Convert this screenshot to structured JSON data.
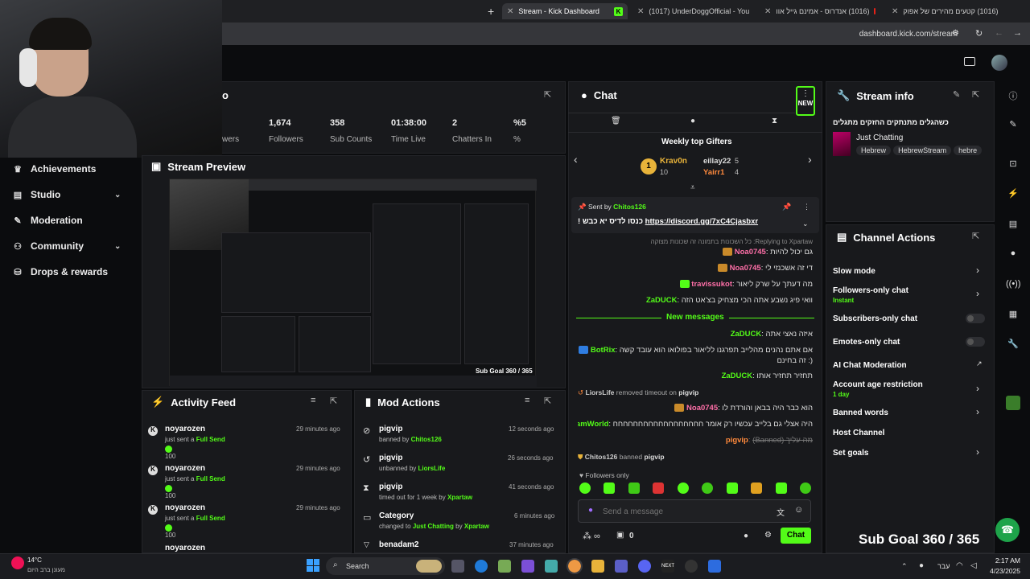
{
  "browser": {
    "tabs": [
      {
        "label": "Stream - Kick Dashboard",
        "active": true
      },
      {
        "label": "(1017) UnderDoggOfficial - You"
      },
      {
        "label": "(1016) אנדרוס - אמינם גייל אוו"
      },
      {
        "label": "(1016) קטעים מהירים של אפוק"
      }
    ],
    "new_tab": "+",
    "url": "dashboard.kick.com/stream"
  },
  "sidebar": {
    "items": [
      {
        "label": "Achievements",
        "icon": "trophy-icon"
      },
      {
        "label": "Studio",
        "icon": "studio-icon",
        "chevron": true
      },
      {
        "label": "Moderation",
        "icon": "wrench-icon"
      },
      {
        "label": "Community",
        "icon": "community-icon",
        "chevron": true
      },
      {
        "label": "Drops & rewards",
        "icon": "drops-icon"
      }
    ]
  },
  "session": {
    "title_suffix": "o",
    "stats": [
      {
        "value": "1,674",
        "label": "Followers"
      },
      {
        "value": "358",
        "label": "Sub Counts"
      },
      {
        "value": "01:38:00",
        "label": "Time Live"
      },
      {
        "value": "2",
        "label": "Chatters In"
      },
      {
        "value": "%5",
        "label": "%"
      }
    ],
    "viewers_label": "wers"
  },
  "preview": {
    "title": "Stream Preview",
    "overlay_goal": "Sub Goal 360 / 365"
  },
  "activity": {
    "title": "Activity Feed",
    "items": [
      {
        "name": "noyarozen",
        "action": "just sent a",
        "gift": "Full Send",
        "amount": "100",
        "time": "29 minutes ago"
      },
      {
        "name": "noyarozen",
        "action": "just sent a",
        "gift": "Full Send",
        "amount": "100",
        "time": "29 minutes ago"
      },
      {
        "name": "noyarozen",
        "action": "just sent a",
        "gift": "Full Send",
        "amount": "100",
        "time": "29 minutes ago"
      },
      {
        "name": "noyarozen"
      }
    ]
  },
  "mod": {
    "title": "Mod Actions",
    "items": [
      {
        "name": "pigvip",
        "prefix": "banned by",
        "by": "Chitos126",
        "time": "12 seconds ago"
      },
      {
        "name": "pigvip",
        "prefix": "unbanned by",
        "by": "LiorsLife",
        "time": "26 seconds ago"
      },
      {
        "name": "pigvip",
        "prefix": "timed out for 1 week by",
        "by": "Xpartaw",
        "time": "41 seconds ago"
      },
      {
        "name": "Category",
        "prefix": "changed to",
        "by": "Just Chatting",
        "by2": "by",
        "by3": "Xpartaw",
        "time": "6 minutes ago"
      },
      {
        "name": "benadam2",
        "time": "37 minutes ago"
      }
    ]
  },
  "chat": {
    "title": "Chat",
    "new_badge": "NEW",
    "gifters_title": "Weekly top Gifters",
    "gifters": [
      {
        "rank": "1",
        "name": "Krav0n",
        "value": "10"
      },
      {
        "name": "eillay22",
        "value": "5"
      },
      {
        "name": "Yairr1",
        "value": "4"
      }
    ],
    "pinned": {
      "sent_by": "Sent by",
      "user": "Chitos126",
      "text_prefix": "! כנסו לדיס יא כבש",
      "link": "https://discord.gg/7xC4Cjasbxr"
    },
    "replying": "Replying to Xpartaw: כל השכונות בתמונה זה שכונות מצוקה",
    "messages": [
      {
        "user": "Noa0745",
        "color": "pink",
        "text": "גם יכול להיות"
      },
      {
        "user": "Noa0745",
        "color": "pink",
        "text": "די זה אשכנזי לי"
      },
      {
        "user": "travissukot",
        "color": "pink",
        "text": "מה דעתך על שרק ליאור"
      },
      {
        "user": "ZaDUCK",
        "color": "green",
        "text": "וואי פיג נשבע אתה הכי מצחיק בצ'אט הזה"
      }
    ],
    "new_messages": "New messages",
    "messages2": [
      {
        "user": "ZaDUCK",
        "color": "green",
        "text": "איזה נאצי אתה"
      },
      {
        "user": "BotRix",
        "color": "green",
        "text": "אם אתם נהנים מהלייב תפרגנו לליאור בפולואו הוא עובד קשה",
        "text2": "(: זה בחינם"
      },
      {
        "user": "ZaDUCK",
        "color": "green",
        "text": "תחזיר תחזיר אותו"
      }
    ],
    "sys1_user": "LiorsLife",
    "sys1_text": "removed timeout on",
    "sys1_target": "pigvip",
    "msg_noa": {
      "user": "Noa0745",
      "text": "הוא כבר היה בבאן והורדת לו"
    },
    "msg_noam": {
      "user": "NoamWorld",
      "text": "היה אצלי גם בלייב עכשיו רק אומר חחחחחחחחחחחחחחחחחח"
    },
    "msg_pig": {
      "user": "pigvip",
      "text": "מה עליך (Banned)"
    },
    "sys2_user": "Chitos126",
    "sys2_text": "banned",
    "sys2_target": "pigvip",
    "followers_only": "Followers only",
    "placeholder": "Send a message",
    "viewers": "0",
    "send": "Chat"
  },
  "stream_info": {
    "title": "Stream info",
    "stream_title": "כשהגלים מתנתקים החזקים מתגלים",
    "category": "Just Chatting",
    "tags": [
      "Hebrew",
      "HebrewStream",
      "hebre"
    ]
  },
  "channel_actions": {
    "title": "Channel Actions",
    "items": [
      {
        "label": "Slow mode",
        "type": "arrow"
      },
      {
        "label": "Followers-only chat",
        "sub": "Instant",
        "type": "arrow"
      },
      {
        "label": "Subscribers-only chat",
        "type": "toggle"
      },
      {
        "label": "Emotes-only chat",
        "type": "toggle"
      },
      {
        "label": "AI Chat Moderation",
        "type": "link"
      },
      {
        "label": "Account age restriction",
        "sub": "1 day",
        "type": "arrow"
      },
      {
        "label": "Banned words",
        "type": "arrow"
      },
      {
        "label": "Host Channel",
        "type": "none"
      },
      {
        "label": "Set goals",
        "type": "arrow"
      }
    ]
  },
  "overlay_goal": "Sub Goal 360 / 365",
  "taskbar": {
    "weather_temp": "14°C",
    "weather_desc": "מעונן ברב היום",
    "search": "Search",
    "lang": "עבר",
    "time": "2:17 AM",
    "date": "4/23/2025"
  },
  "colors": {
    "accent": "#53fc18",
    "panel": "#18191c",
    "bg": "#0b0c0e",
    "pink": "#ff6fa8"
  }
}
